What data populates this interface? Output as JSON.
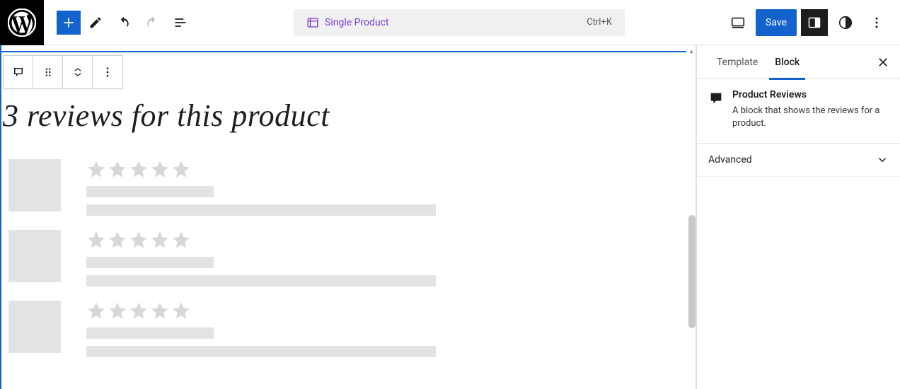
{
  "topbar": {
    "search_label": "Single Product",
    "shortcut": "Ctrl+K",
    "save_label": "Save"
  },
  "canvas": {
    "heading": "3 reviews for this product",
    "review_count": 3,
    "stars_per_review": 5
  },
  "sidebar": {
    "tabs": {
      "template": "Template",
      "block": "Block"
    },
    "block_name": "Product Reviews",
    "block_description": "A block that shows the reviews for a product.",
    "panel_advanced": "Advanced"
  }
}
